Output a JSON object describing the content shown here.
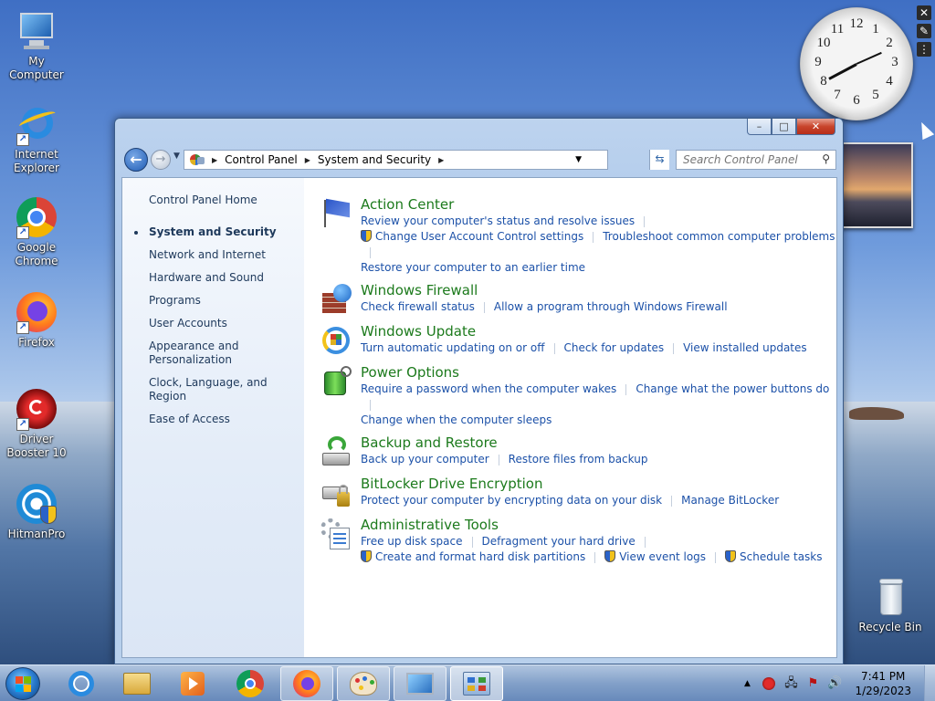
{
  "desktop": {
    "icons": [
      {
        "label": "My Computer"
      },
      {
        "label": "Internet Explorer"
      },
      {
        "label": "Google Chrome"
      },
      {
        "label": "Firefox"
      },
      {
        "label": "Driver Booster 10"
      },
      {
        "label": "HitmanPro"
      },
      {
        "label": "Recycle Bin"
      }
    ]
  },
  "clock_gadget": {
    "numbers": [
      "12",
      "1",
      "2",
      "3",
      "4",
      "5",
      "6",
      "7",
      "8",
      "9",
      "10",
      "11"
    ]
  },
  "window": {
    "buttons": {
      "minimize": "–",
      "maximize": "□",
      "close": "✕"
    },
    "address": {
      "crumbs": [
        "Control Panel",
        "System and Security"
      ]
    },
    "search": {
      "placeholder": "Search Control Panel"
    },
    "left_nav": {
      "home": "Control Panel Home",
      "items": [
        "System and Security",
        "Network and Internet",
        "Hardware and Sound",
        "Programs",
        "User Accounts",
        "Appearance and Personalization",
        "Clock, Language, and Region",
        "Ease of Access"
      ],
      "current_index": 0
    },
    "categories": [
      {
        "title": "Action Center",
        "icon": "flag-icon",
        "rows": [
          [
            {
              "text": "Review your computer's status and resolve issues",
              "shield": false
            }
          ],
          [
            {
              "text": "Change User Account Control settings",
              "shield": true
            },
            {
              "text": "Troubleshoot common computer problems",
              "shield": false
            }
          ],
          [
            {
              "text": "Restore your computer to an earlier time",
              "shield": false
            }
          ]
        ]
      },
      {
        "title": "Windows Firewall",
        "icon": "firewall-icon",
        "rows": [
          [
            {
              "text": "Check firewall status",
              "shield": false
            },
            {
              "text": "Allow a program through Windows Firewall",
              "shield": false
            }
          ]
        ]
      },
      {
        "title": "Windows Update",
        "icon": "windows-update-icon",
        "rows": [
          [
            {
              "text": "Turn automatic updating on or off",
              "shield": false
            },
            {
              "text": "Check for updates",
              "shield": false
            },
            {
              "text": "View installed updates",
              "shield": false
            }
          ]
        ]
      },
      {
        "title": "Power Options",
        "icon": "battery-icon",
        "rows": [
          [
            {
              "text": "Require a password when the computer wakes",
              "shield": false
            },
            {
              "text": "Change what the power buttons do",
              "shield": false
            }
          ],
          [
            {
              "text": "Change when the computer sleeps",
              "shield": false
            }
          ]
        ]
      },
      {
        "title": "Backup and Restore",
        "icon": "backup-icon",
        "rows": [
          [
            {
              "text": "Back up your computer",
              "shield": false
            },
            {
              "text": "Restore files from backup",
              "shield": false
            }
          ]
        ]
      },
      {
        "title": "BitLocker Drive Encryption",
        "icon": "bitlocker-icon",
        "rows": [
          [
            {
              "text": "Protect your computer by encrypting data on your disk",
              "shield": false
            },
            {
              "text": "Manage BitLocker",
              "shield": false
            }
          ]
        ]
      },
      {
        "title": "Administrative Tools",
        "icon": "admin-tools-icon",
        "rows": [
          [
            {
              "text": "Free up disk space",
              "shield": false
            },
            {
              "text": "Defragment your hard drive",
              "shield": false
            }
          ],
          [
            {
              "text": "Create and format hard disk partitions",
              "shield": true
            },
            {
              "text": "View event logs",
              "shield": true
            },
            {
              "text": "Schedule tasks",
              "shield": true
            }
          ]
        ]
      }
    ]
  },
  "taskbar": {
    "time": "7:41 PM",
    "date": "1/29/2023"
  },
  "colors": {
    "link": "#1c51a8",
    "category_title": "#1c7a1c",
    "nav_text": "#1e395b"
  }
}
